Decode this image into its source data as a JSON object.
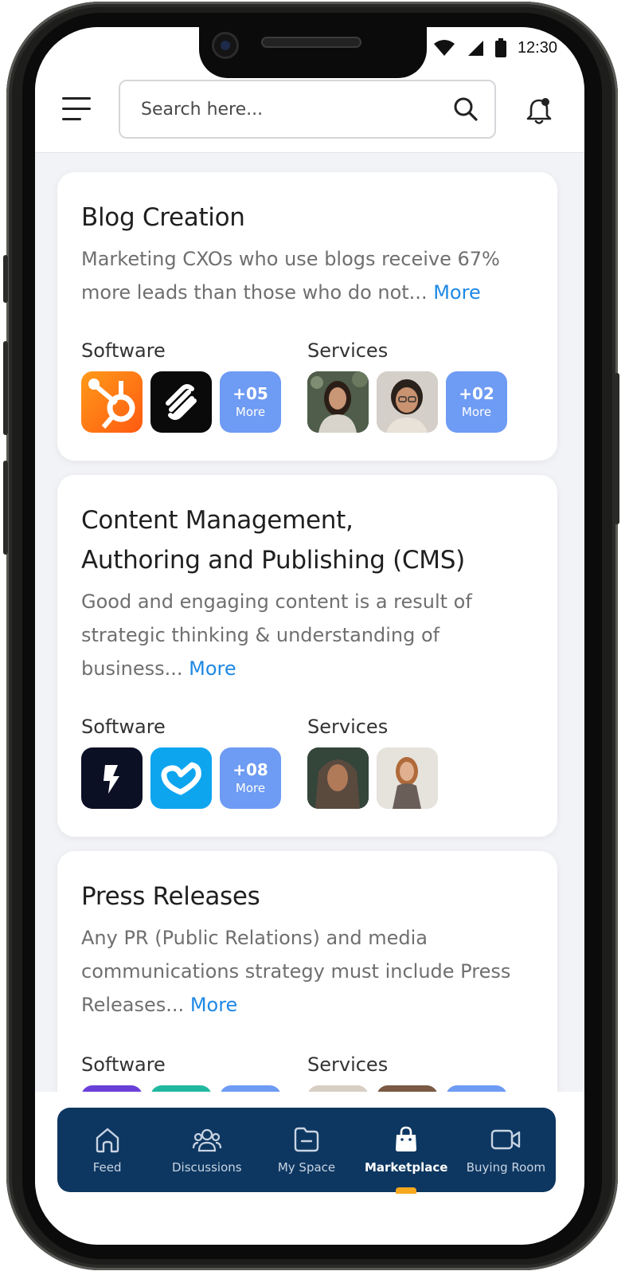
{
  "status_bar": {
    "time": "12:30"
  },
  "header": {
    "search_placeholder": "Search here..."
  },
  "cards": [
    {
      "title": "Blog Creation",
      "description": "Marketing CXOs who use blogs receive 67% more leads than those who do not...",
      "more": "More",
      "software_label": "Software",
      "services_label": "Services",
      "software_more_count": "+05",
      "software_more_label": "More",
      "services_more_count": "+02",
      "services_more_label": "More"
    },
    {
      "title_line1": "Content Management,",
      "title_line2": "Authoring and Publishing (CMS)",
      "description": "Good and engaging content is a result of strategic thinking & understanding of business...",
      "more": "More",
      "software_label": "Software",
      "services_label": "Services",
      "software_more_count": "+08",
      "software_more_label": "More"
    },
    {
      "title": "Press Releases",
      "description": "Any PR (Public Relations) and media communications strategy must include Press Releases...",
      "more": "More",
      "software_label": "Software",
      "services_label": "Services"
    }
  ],
  "bottom_nav": [
    {
      "label": "Feed",
      "icon": "home-icon"
    },
    {
      "label": "Discussions",
      "icon": "people-icon"
    },
    {
      "label": "My Space",
      "icon": "folder-icon"
    },
    {
      "label": "Marketplace",
      "icon": "shopping-bag-icon",
      "active": true
    },
    {
      "label": "Buying Room",
      "icon": "video-icon"
    }
  ],
  "colors": {
    "accent_blue": "#1e88e5",
    "more_tile": "#6e9bf3",
    "nav_background": "#0d3761",
    "nav_indicator": "#f6a81e"
  }
}
